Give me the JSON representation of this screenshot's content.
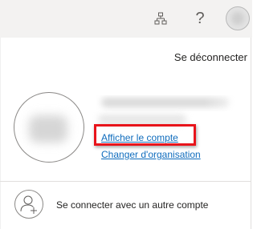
{
  "header": {
    "org_icon": "organization-icon",
    "help_icon": "help-icon",
    "help_glyph": "?",
    "avatar_icon": "account-avatar-icon"
  },
  "account_panel": {
    "signout_label": "Se déconnecter",
    "view_account_label": "Afficher le compte",
    "change_org_label": "Changer d'organisation",
    "other_account_label": "Se connecter avec un autre compte",
    "add_account_icon": "add-person-icon"
  },
  "colors": {
    "link": "#0f6cbd",
    "highlight": "#e8141b",
    "topbar": "#f3f2f1"
  }
}
